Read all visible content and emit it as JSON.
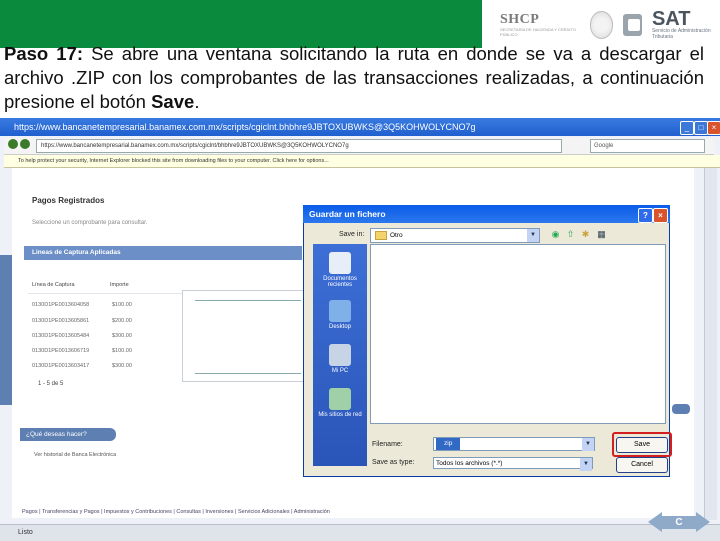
{
  "header": {
    "logo_shcp": "SHCP",
    "logo_shcp_sub": "SECRETARÍA DE HACIENDA Y CRÉDITO PÚBLICO",
    "logo_sat": "SAT",
    "logo_sat_sub": "Servicio de Administración Tributaria",
    "brand_green": "#0a8a3c"
  },
  "instruction": {
    "step": "Paso 17:",
    "text": " Se abre una ventana solicitando la ruta en donde se va a descargar el archivo .ZIP con los comprobantes de las transacciones realizadas, a continuación presione el botón ",
    "button_name": "Save",
    "end": "."
  },
  "browser": {
    "title": "https://www.bancanetempresarial.banamex.com.mx/scripts/cgiclnt.bhbhre9JBTOXUBWKS@3Q5KOHWOLYCNO7g",
    "address": "https://www.bancanetempresarial.banamex.com.mx/scripts/cgiclnt/bhbhre9JBTOXUBWKS@3Q5KOHWOLYCNO7g",
    "search_placeholder": "Google",
    "infobar": "To help protect your security, Internet Explorer blocked this site from downloading files to your computer. Click here for options...",
    "status": "Listo"
  },
  "page": {
    "title": "Pagos Registrados",
    "subtitle": "Seleccione un comprobante para consultar.",
    "section": "Lineas de Captura Aplicadas",
    "columns": [
      "Línea de Captura",
      "Importe"
    ],
    "rows": [
      [
        "0130D1PE0013604058",
        "$100.00"
      ],
      [
        "0130D1PE0013605861",
        "$200.00"
      ],
      [
        "0130D1PE0013605484",
        "$300.00"
      ],
      [
        "0130D1PE0013606719",
        "$100.00"
      ],
      [
        "0130D1PE0013603417",
        "$300.00"
      ]
    ],
    "rows_count": "1 - 5 de 5",
    "que_deseas": "¿Qué deseas hacer?",
    "historial": "Ver historial de Banca Electrónica",
    "footer": "Pagos | Transferencias y Pagos | Impuestos y Contribuciones | Consultas | Inversiones | Servicios Adicionales | Administración"
  },
  "dialog": {
    "title": "Guardar un fichero",
    "save_in_label": "Save in:",
    "save_in_value": "Otro",
    "places": [
      "Documentos recientes",
      "Desktop",
      "Mi PC",
      "Mis sitios de red"
    ],
    "filename_label": "Filename:",
    "filename_value": "zip",
    "filetype_label": "Save as type:",
    "filetype_value": "Todos los archivos (*.*)",
    "save_label": "Save",
    "cancel_label": "Cancel",
    "highlight_color": "#d31f1f"
  },
  "nav": {
    "label": "C"
  }
}
